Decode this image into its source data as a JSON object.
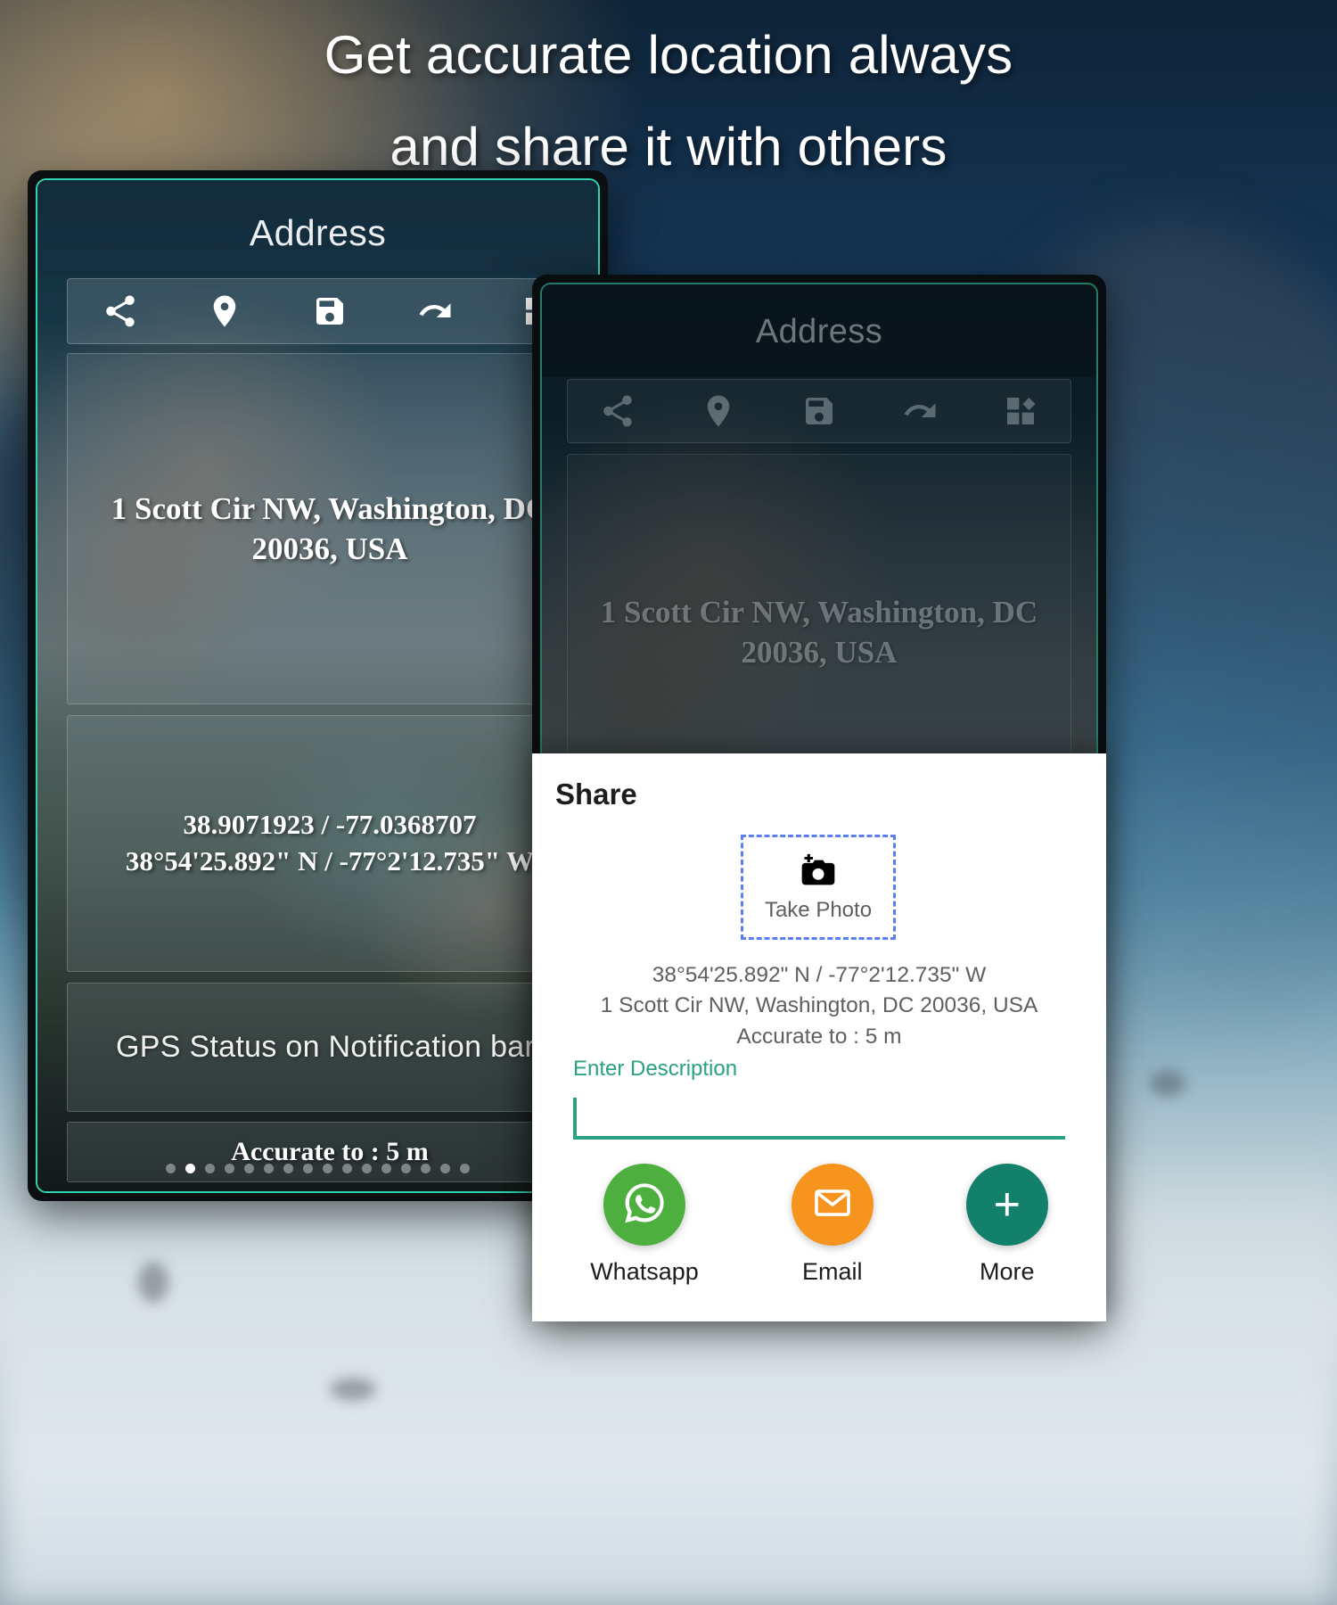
{
  "headline": {
    "line1": "Get accurate location always",
    "line2": "and share it with others"
  },
  "colors": {
    "accent_teal": "#2fd3ae",
    "field_teal": "#2aa183",
    "whatsapp_green": "#4caf3e",
    "email_orange": "#f7941e",
    "more_teal": "#12806a",
    "dashed_blue": "#5b7ef0"
  },
  "phone_back": {
    "title": "Address",
    "toolbar": [
      {
        "name": "share-icon",
        "label": "Share"
      },
      {
        "name": "location-pin-icon",
        "label": "Location"
      },
      {
        "name": "save-icon",
        "label": "Save"
      },
      {
        "name": "refresh-icon",
        "label": "Refresh"
      },
      {
        "name": "grid-icon",
        "label": "Widgets"
      }
    ],
    "address": "1 Scott Cir NW, Washington, DC 20036, USA",
    "coordinates_decimal": "38.9071923 / -77.0368707",
    "coordinates_dms": "38°54'25.892\" N / -77°2'12.735\" W",
    "gps_status": "GPS Status on Notification bar",
    "accuracy": "Accurate to : 5 m",
    "pager": {
      "total": 16,
      "active_index": 1
    }
  },
  "phone_front": {
    "title": "Address",
    "toolbar": [
      {
        "name": "share-icon",
        "label": "Share"
      },
      {
        "name": "location-pin-icon",
        "label": "Location"
      },
      {
        "name": "save-icon",
        "label": "Save"
      },
      {
        "name": "refresh-icon",
        "label": "Refresh"
      },
      {
        "name": "grid-icon",
        "label": "Widgets"
      }
    ],
    "address": "1 Scott Cir NW, Washington, DC 20036, USA"
  },
  "share_sheet": {
    "title": "Share",
    "take_photo_label": "Take Photo",
    "info_line1": "38°54'25.892\" N / -77°2'12.735\" W",
    "info_line2": "1 Scott Cir NW, Washington, DC 20036, USA",
    "info_line3": "Accurate to : 5 m",
    "description_label": "Enter Description",
    "description_value": "",
    "actions": [
      {
        "label": "Whatsapp",
        "icon": "whatsapp-icon"
      },
      {
        "label": "Email",
        "icon": "email-icon"
      },
      {
        "label": "More",
        "icon": "plus-icon"
      }
    ]
  }
}
